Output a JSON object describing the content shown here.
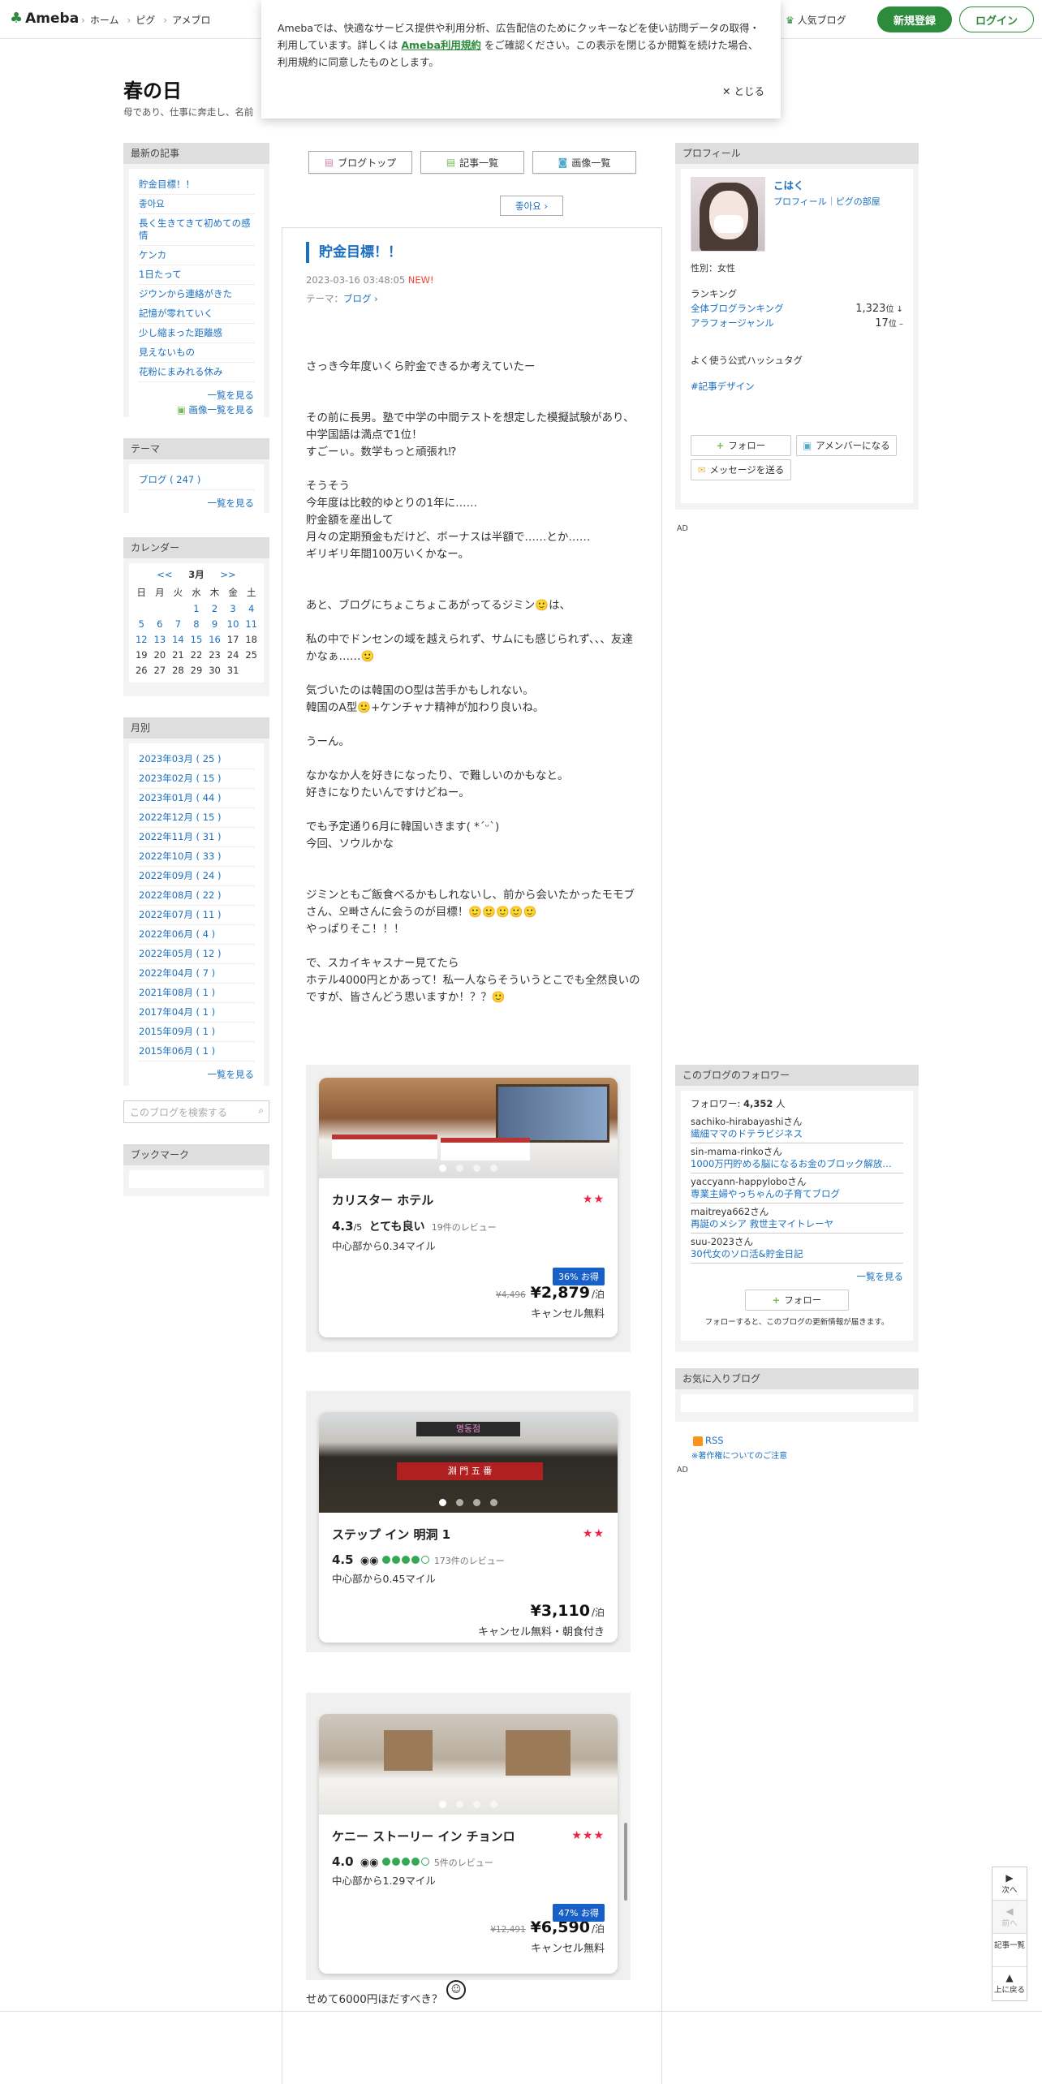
{
  "header": {
    "logo": "Ameba",
    "nav": [
      "ホーム",
      "ピグ",
      "アメブロ"
    ],
    "popular": "人気ブログ",
    "signup": "新規登録",
    "login": "ログイン"
  },
  "cookie": {
    "text_1": "Amebaでは、快適なサービス提供や利用分析、広告配信のためにクッキーなどを使い訪問データの取得・利用しています。詳しくは",
    "link": "Ameba利用規約",
    "text_2": "をご確認ください。この表示を閉じるか閲覧を続けた場合、利用規約に同意したものとします。",
    "close": "✕ とじる"
  },
  "blog": {
    "title": "春の日",
    "desc": "母であり、仕事に奔走し、名前"
  },
  "left": {
    "recent_h": "最新の記事",
    "recent": [
      "貯金目標！！",
      "좋아요",
      "長く生きてきて初めての感情",
      "ケンカ",
      "1日たって",
      "ジウンから連絡がきた",
      "記憶が零れていく",
      "少し縮まった距離感",
      "見えないもの",
      "花粉にまみれる休み"
    ],
    "recent_more": "一覧を見る",
    "recent_img_more": "画像一覧を見る",
    "theme_h": "テーマ",
    "theme_item": "ブログ ( 247 )",
    "theme_more": "一覧を見る",
    "cal_h": "カレンダー",
    "cal_prev": "<<",
    "cal_month": "3月",
    "cal_next": ">>",
    "cal_days": [
      "日",
      "月",
      "火",
      "水",
      "木",
      "金",
      "土"
    ],
    "cal_rows": [
      [
        "",
        "",
        "",
        "1",
        "2",
        "3",
        "4"
      ],
      [
        "5",
        "6",
        "7",
        "8",
        "9",
        "10",
        "11"
      ],
      [
        "12",
        "13",
        "14",
        "15",
        "16",
        "17",
        "18"
      ],
      [
        "19",
        "20",
        "21",
        "22",
        "23",
        "24",
        "25"
      ],
      [
        "26",
        "27",
        "28",
        "29",
        "30",
        "31",
        ""
      ]
    ],
    "cal_linked": [
      "1",
      "2",
      "3",
      "4",
      "5",
      "6",
      "7",
      "8",
      "9",
      "10",
      "11",
      "12",
      "13",
      "14",
      "15",
      "16"
    ],
    "monthly_h": "月別",
    "monthly": [
      "2023年03月 ( 25 )",
      "2023年02月 ( 15 )",
      "2023年01月 ( 44 )",
      "2022年12月 ( 15 )",
      "2022年11月 ( 31 )",
      "2022年10月 ( 33 )",
      "2022年09月 ( 24 )",
      "2022年08月 ( 22 )",
      "2022年07月 ( 11 )",
      "2022年06月 ( 4 )",
      "2022年05月 ( 12 )",
      "2022年04月 ( 7 )",
      "2021年08月 ( 1 )",
      "2017年04月 ( 1 )",
      "2015年09月 ( 1 )",
      "2015年06月 ( 1 )"
    ],
    "monthly_more": "一覧を見る",
    "search_placeholder": "このブログを検索する",
    "bookmark_h": "ブックマーク"
  },
  "main": {
    "btn_top": "ブログトップ",
    "btn_list": "記事一覧",
    "btn_images": "画像一覧",
    "like": "좋아요",
    "title": "貯金目標！！",
    "date": "2023-03-16 03:48:05",
    "new": "NEW!",
    "theme_label": "テーマ：",
    "theme": "ブログ",
    "paragraphs": [
      [
        "さっき今年度いくら貯金できるか考えていたー"
      ],
      [
        "その前に長男。塾で中学の中間テストを想定した模擬試験があり、中学国語は満点で1位！",
        "すごーぃ。数学もっと頑張れ⁉"
      ],
      [
        "そうそう",
        "今年度は比較的ゆとりの1年に……",
        "貯金額を産出して",
        "月々の定期預金もだけど、ボーナスは半額で……とか……",
        "ギリギリ年間100万いくかなー。"
      ],
      [
        "あと、ブログにちょこちょこあがってるジミン🙂は、"
      ],
      [
        "私の中でドンセンの域を越えられず、サムにも感じられず、、、友達かなぁ……🙂"
      ],
      [
        "気づいたのは韓国のO型は苦手かもしれない。",
        "韓国のA型🙂+ケンチャナ精神が加わり良いね。"
      ],
      [
        "うーん。"
      ],
      [
        "なかなか人を好きになったり、で難しいのかもなと。",
        "好きになりたいんですけどねー。"
      ],
      [
        "でも予定通り6月に韓国いきます( *ˊᵕˋ)",
        "今回、ソウルかな"
      ],
      [
        "ジミンともご飯食べるかもしれないし、前から会いたかったモモブさん、오빠さんに会うのが目標！🙂🙂🙂🙂🙂",
        "やっぱりそこ！！！"
      ],
      [
        "で、スカイキャスナー見てたら",
        "ホテル4000円とかあって！私一人ならそういうとこでも全然良いのですが、皆さんどう思いますか！？？🙂"
      ]
    ],
    "tail": "せめて6000円ほだすべき？"
  },
  "hotels": [
    {
      "name": "カリスター ホテル",
      "stars": "★★",
      "score": "4.3",
      "scale": "/5",
      "word": "とても良い",
      "reviews": "19件のレビュー",
      "dist": "中心部から0.34マイル",
      "badge": "36% お得",
      "old": "¥4,496",
      "price": "¥2,879",
      "unit": "/泊",
      "cancel": "キャンセル無料"
    },
    {
      "name": "ステップ イン 明洞 1",
      "stars": "★★",
      "score": "4.5",
      "reviews": "173件のレビュー",
      "dist": "中心部から0.45マイル",
      "price": "¥3,110",
      "unit": "/泊",
      "cancel": "キャンセル無料・朝食付き"
    },
    {
      "name": "ケニー ストーリー イン チョンロ",
      "stars": "★★★",
      "score": "4.0",
      "reviews": "5件のレビュー",
      "dist": "中心部から1.29マイル",
      "badge": "47% お得",
      "old": "¥12,491",
      "price": "¥6,590",
      "unit": "/泊",
      "cancel": "キャンセル無料"
    }
  ],
  "hotel2_sign": "명동점",
  "hotel2_sign2": "淵 門 五 番",
  "profile": {
    "h": "プロフィール",
    "name": "こはく",
    "links": "プロフィール｜ピグの部屋",
    "gender": "性別：女性",
    "rank_h": "ランキング",
    "rank1": "全体ブログランキング",
    "rank1_v": "1,323",
    "rank1_u": "位 ↓",
    "rank2": "アラフォージャンル",
    "rank2_v": "17",
    "rank2_u": "位 –",
    "hashtag_h": "よく使う公式ハッシュタグ",
    "hashtag": "#記事デザイン",
    "follow": "フォロー",
    "member": "アメンバーになる",
    "message": "メッセージを送る"
  },
  "ad_label": "AD",
  "followers": {
    "h": "このブログのフォロワー",
    "count_label": "フォロワー:",
    "count": "4,352",
    "count_unit": "人",
    "list": [
      {
        "user": "sachiko-hirabayashiさん",
        "blog": "繊細ママのドテラビジネス"
      },
      {
        "user": "sin-mama-rinkoさん",
        "blog": "1000万円貯める脳になるお金のブロック解放…"
      },
      {
        "user": "yaccyann-happyloboさん",
        "blog": "専業主婦やっちゃんの子育てブログ"
      },
      {
        "user": "maitreya662さん",
        "blog": "再誕のメシア 救世主マイトレーヤ"
      },
      {
        "user": "suu-2023さん",
        "blog": "30代女のソロ活&貯金日記"
      }
    ],
    "more": "一覧を見る",
    "follow": "フォロー",
    "note": "フォローすると、このブログの更新情報が届きます。"
  },
  "favs_h": "お気に入りブログ",
  "rss": "RSS",
  "copyright": "※著作権についてのご注意",
  "rnav": {
    "next": "次へ",
    "prev": "前へ",
    "list": "記事一覧",
    "top": "上に戻る"
  }
}
